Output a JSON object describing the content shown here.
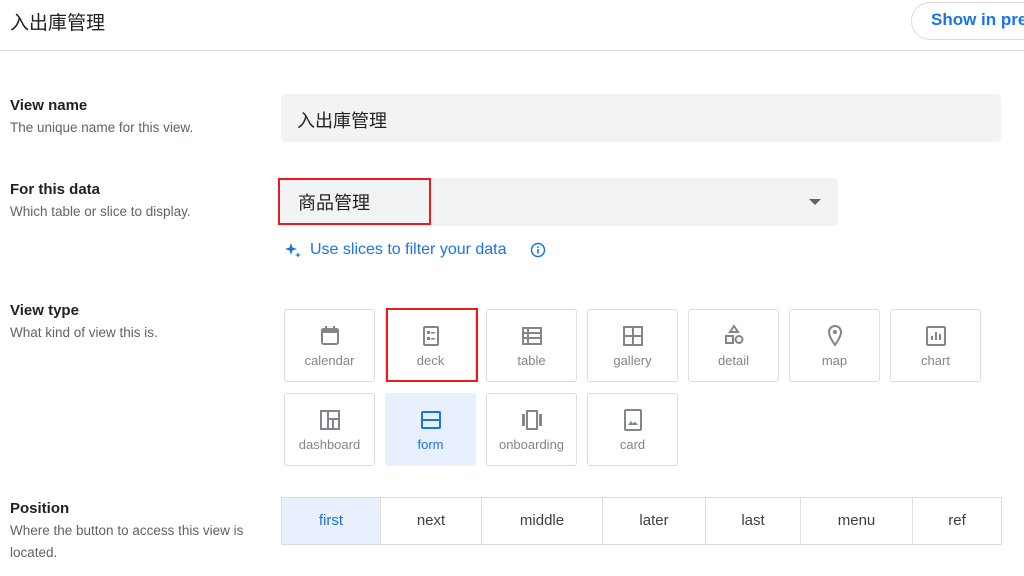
{
  "header": {
    "title": "入出庫管理",
    "preview_button": "Show in pre"
  },
  "view_name": {
    "label": "View name",
    "description": "The unique name for this view.",
    "value": "入出庫管理"
  },
  "for_this_data": {
    "label": "For this data",
    "description": "Which table or slice to display.",
    "value": "商品管理",
    "slices_link": "Use slices to filter your data"
  },
  "view_type": {
    "label": "View type",
    "description": "What kind of view this is.",
    "selected": "form",
    "highlighted": "deck",
    "options": [
      {
        "label": "calendar",
        "icon": "calendar-icon"
      },
      {
        "label": "deck",
        "icon": "deck-icon"
      },
      {
        "label": "table",
        "icon": "table-icon"
      },
      {
        "label": "gallery",
        "icon": "gallery-icon"
      },
      {
        "label": "detail",
        "icon": "detail-icon"
      },
      {
        "label": "map",
        "icon": "map-pin-icon"
      },
      {
        "label": "chart",
        "icon": "chart-icon"
      },
      {
        "label": "dashboard",
        "icon": "dashboard-icon"
      },
      {
        "label": "form",
        "icon": "form-icon"
      },
      {
        "label": "onboarding",
        "icon": "onboarding-icon"
      },
      {
        "label": "card",
        "icon": "card-icon"
      }
    ]
  },
  "position": {
    "label": "Position",
    "description": "Where the button to access this view is located.",
    "selected": "first",
    "options": [
      "first",
      "next",
      "middle",
      "later",
      "last",
      "menu",
      "ref"
    ]
  },
  "colors": {
    "accent": "#1a73e8",
    "highlight_box": "#e81c1c",
    "selected_bg": "#e8f0fe"
  }
}
